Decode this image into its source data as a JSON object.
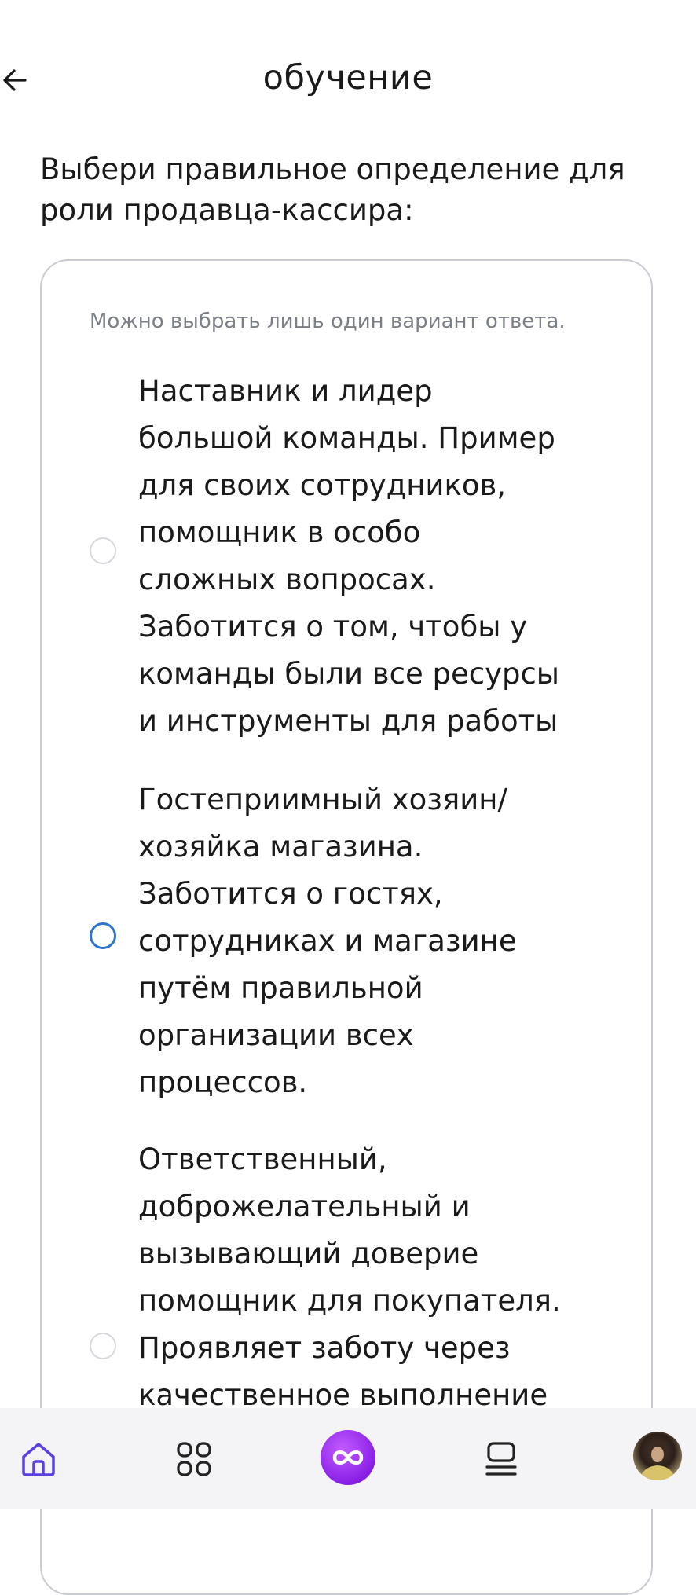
{
  "header": {
    "title": "обучение",
    "back_icon": "arrow-left-icon"
  },
  "question": {
    "text": "Выбери правильное определение для роли продавца-кассира:",
    "hint": "Можно выбрать лишь один вариант ответа."
  },
  "options": [
    {
      "text": "Наставник и лидер\nбольшой команды. Пример\nдля своих сотрудников,\nпомощник в особо\nсложных вопросах.\nЗаботится о том, чтобы у\nкоманды были все ресурсы\nи инструменты для работы",
      "selected": false
    },
    {
      "text": "Гостеприимный хозяин/\nхозяйка магазина.\nЗаботится о гостях,\nсотрудниках и магазине\nпутём правильной\nорганизации всех\nпроцессов.",
      "selected": false
    },
    {
      "text": "Ответственный,\nдоброжелательный и\nвызывающий доверие\nпомощник для покупателя.\nПроявляет заботу через\nкачественное выполнение",
      "selected": false
    }
  ],
  "bottom_nav": {
    "items": [
      "home-icon",
      "grid-icon",
      "infinity-icon",
      "courses-icon",
      "profile-avatar"
    ]
  },
  "colors": {
    "accent_blue": "#2f74d0",
    "brand_purple": "#8a1fe6",
    "nav_icon": "#222222",
    "home_active": "#5b3fe0"
  }
}
